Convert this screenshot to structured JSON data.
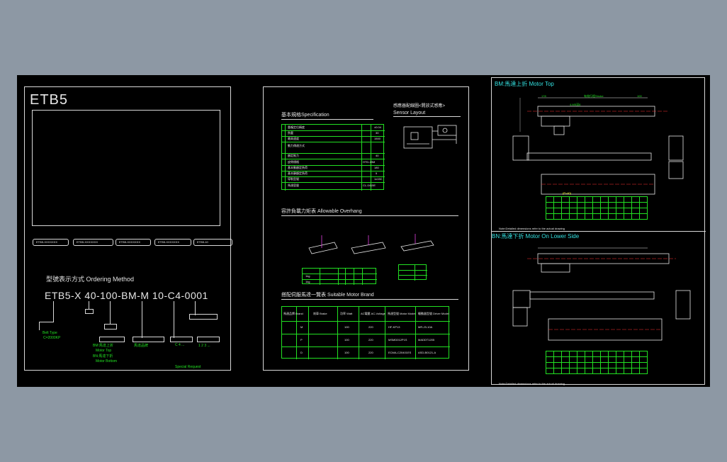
{
  "left_sheet": {
    "title": "ETB5",
    "pills": [
      "ETB5-XXXXXXX",
      "ETB5-XXXXXXX",
      "ETB5-XXXXXXX",
      "ETB5-XXXXXXX",
      "ETB5-10"
    ],
    "ordering_heading": "型號表示方式 Ordering Method",
    "ordering_code": "ETB5-X 40-100-BM-M 10-C4-0001",
    "labels": {
      "type": "Belt Type",
      "type_value": "C=2000KP",
      "stroke": "Stroke",
      "motor": "Motor",
      "bm_top": "BM:馬達上折",
      "motor_top": "Motor Top",
      "bn": "BN:馬達下折",
      "motor_bottom": "Motor Bottom",
      "brand": "馬達品牌",
      "special": "Special Request"
    }
  },
  "middle_sheet": {
    "spec_heading": "基本規格Specification",
    "sensor_heading": "感應器配線圖<開放式感應>",
    "sensor_heading_en": "Sensor Layout",
    "overhang_heading": "容許負載力矩表 Allowable Overhang",
    "motor_heading": "搭配伺服馬達一覽表 Suitable Motor Brand",
    "spec_rows": [
      [
        "重複定位精度",
        "mm",
        "±0.04"
      ],
      [
        "負載",
        "kg",
        "30"
      ],
      [
        "最高速度",
        "mm/s",
        "1500"
      ],
      [
        "動力傳達方式",
        "",
        "皮帶"
      ],
      [
        "",
        "",
        ""
      ],
      [
        "額定推力",
        "N",
        "40"
      ],
      [
        "皮帶規格",
        "",
        "HTD-15M"
      ],
      [
        "基本動額定負荷",
        "N",
        "180"
      ],
      [
        "基本靜額定負荷",
        "N",
        "5"
      ],
      [
        "導軌型號",
        "",
        "1x15C"
      ],
      [
        "馬達容量",
        "W",
        "CL-0415E"
      ]
    ],
    "overhang_table": {
      "headers": [
        "Ma",
        "Mb",
        "Mc"
      ],
      "rows": [
        [
          "1kg",
          "10",
          "15",
          "20"
        ],
        [
          "1kg",
          "15",
          "10",
          "22"
        ]
      ]
    },
    "motor_table": {
      "headers": [
        "馬達品牌 Brand",
        "標記 Mark",
        "刹車 Brake",
        "功率 Watt",
        "AC電壓 AC-Voltage",
        "馬達型號 Motor Model",
        "驅動器型號 Driver Model"
      ],
      "rows": [
        [
          "三菱 Mitsubishi",
          "M",
          "無 N",
          "100",
          "220",
          "HF-KP13",
          "MR-J3-10A"
        ],
        [
          "松下 Panasonic",
          "P",
          "無 N",
          "100",
          "220",
          "MSMD012P1S",
          "MADDT1205"
        ],
        [
          "台達 Delta",
          "D",
          "無 N",
          "100",
          "220",
          "ECMA-C20401ES",
          "ASD-B0121-A"
        ]
      ]
    }
  },
  "right_sheet": {
    "top_heading": "BM:馬達上折 Motor Top",
    "bottom_heading": "BN:馬達下折 Motor On Lower Side",
    "dims": [
      "178",
      "有效行程Stroke",
      "100",
      "4-M5深8",
      "28",
      "87",
      "(P=40)"
    ],
    "note": "Note:Detailed dimensions refer to the actual drawing"
  }
}
